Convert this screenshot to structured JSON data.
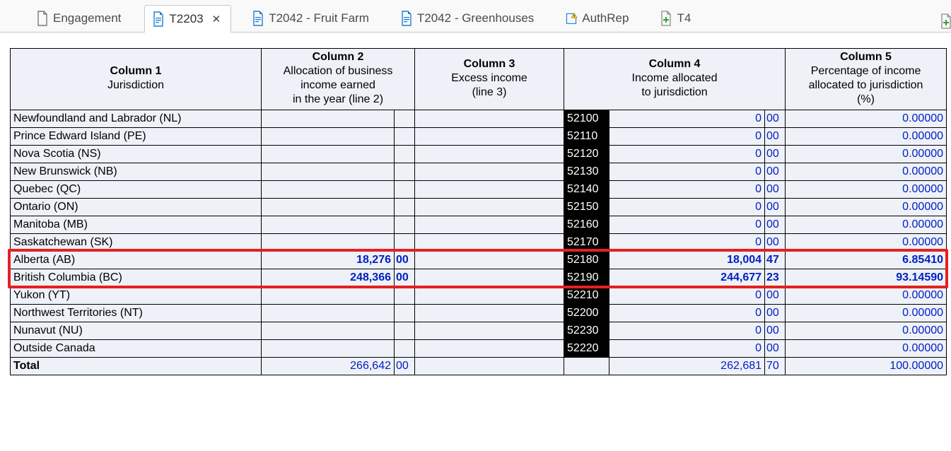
{
  "tabs": [
    {
      "label": "Engagement",
      "kind": "doc-blank"
    },
    {
      "label": "T2203",
      "kind": "doc-blue",
      "active": true,
      "closable": true
    },
    {
      "label": "T2042 - Fruit Farm",
      "kind": "doc-blue"
    },
    {
      "label": "T2042 - Greenhouses",
      "kind": "doc-blue"
    },
    {
      "label": "AuthRep",
      "kind": "doc-warn"
    },
    {
      "label": "T4",
      "kind": "doc-plus"
    }
  ],
  "headers": {
    "c1": {
      "title": "Column 1",
      "sub": "Jurisdiction"
    },
    "c2": {
      "title": "Column 2",
      "sub": "Allocation of business\nincome earned\nin the year (line 2)"
    },
    "c3": {
      "title": "Column 3",
      "sub": "Excess income\n(line 3)"
    },
    "c4": {
      "title": "Column 4",
      "sub": "Income allocated\nto jurisdiction"
    },
    "c5": {
      "title": "Column 5",
      "sub": "Percentage of income\nallocated to jurisdiction\n(%)"
    }
  },
  "rows": [
    {
      "jur": "Newfoundland and Labrador (NL)",
      "code": "52100",
      "c4n": "0",
      "c4c": "00",
      "c5": "0.00000"
    },
    {
      "jur": "Prince Edward Island (PE)",
      "code": "52110",
      "c4n": "0",
      "c4c": "00",
      "c5": "0.00000"
    },
    {
      "jur": "Nova Scotia (NS)",
      "code": "52120",
      "c4n": "0",
      "c4c": "00",
      "c5": "0.00000"
    },
    {
      "jur": "New Brunswick (NB)",
      "code": "52130",
      "c4n": "0",
      "c4c": "00",
      "c5": "0.00000"
    },
    {
      "jur": "Quebec (QC)",
      "code": "52140",
      "c4n": "0",
      "c4c": "00",
      "c5": "0.00000"
    },
    {
      "jur": "Ontario (ON)",
      "code": "52150",
      "c4n": "0",
      "c4c": "00",
      "c5": "0.00000"
    },
    {
      "jur": "Manitoba (MB)",
      "code": "52160",
      "c4n": "0",
      "c4c": "00",
      "c5": "0.00000"
    },
    {
      "jur": "Saskatchewan (SK)",
      "code": "52170",
      "c4n": "0",
      "c4c": "00",
      "c5": "0.00000"
    },
    {
      "jur": "Alberta (AB)",
      "c2n": "18,276",
      "c2c": "00",
      "code": "52180",
      "c4n": "18,004",
      "c4c": "47",
      "c5": "6.85410",
      "bold": true
    },
    {
      "jur": "British Columbia (BC)",
      "c2n": "248,366",
      "c2c": "00",
      "code": "52190",
      "c4n": "244,677",
      "c4c": "23",
      "c5": "93.14590",
      "bold": true
    },
    {
      "jur": "Yukon (YT)",
      "code": "52210",
      "c4n": "0",
      "c4c": "00",
      "c5": "0.00000"
    },
    {
      "jur": "Northwest Territories (NT)",
      "code": "52200",
      "c4n": "0",
      "c4c": "00",
      "c5": "0.00000"
    },
    {
      "jur": "Nunavut (NU)",
      "code": "52230",
      "c4n": "0",
      "c4c": "00",
      "c5": "0.00000"
    },
    {
      "jur": "Outside Canada",
      "code": "52220",
      "c4n": "0",
      "c4c": "00",
      "c5": "0.00000"
    }
  ],
  "total": {
    "jur": "Total",
    "c2n": "266,642",
    "c2c": "00",
    "c4n": "262,681",
    "c4c": "70",
    "c5": "100.00000"
  },
  "highlight_row_indices": [
    8,
    9
  ]
}
